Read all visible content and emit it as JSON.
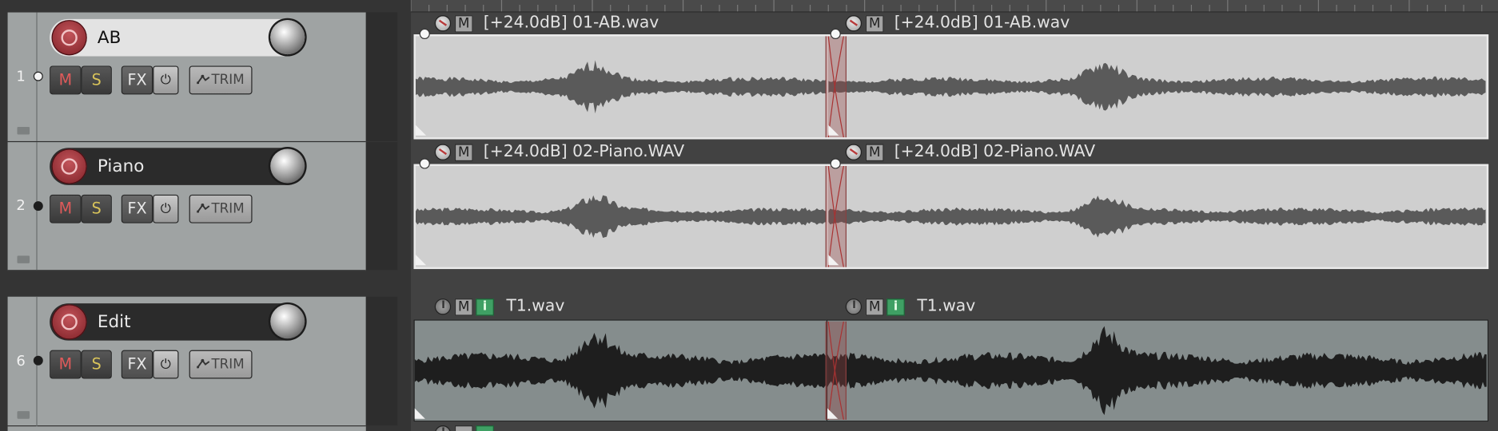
{
  "tracks": [
    {
      "number": "1",
      "name": "AB",
      "selected": true
    },
    {
      "number": "2",
      "name": "Piano",
      "selected": false
    },
    {
      "number": "6",
      "name": "Edit",
      "selected": false
    }
  ],
  "buttons": {
    "mute": "M",
    "solo": "S",
    "fx": "FX",
    "trim": "TRIM"
  },
  "items": {
    "ab_left": {
      "mute": "M",
      "label": "[+24.0dB] 01-AB.wav"
    },
    "ab_right": {
      "mute": "M",
      "label": "[+24.0dB] 01-AB.wav"
    },
    "piano_left": {
      "mute": "M",
      "label": "[+24.0dB] 02-Piano.WAV"
    },
    "piano_right": {
      "mute": "M",
      "label": "[+24.0dB] 02-Piano.WAV"
    },
    "edit_left": {
      "mute": "M",
      "info": "i",
      "label": "T1.wav"
    },
    "edit_right": {
      "mute": "M",
      "info": "i",
      "label": "T1.wav"
    }
  },
  "icons": {
    "record": "record-arm-icon",
    "volume": "volume-knob-icon",
    "power": "power-icon",
    "envelope": "envelope-icon",
    "folder": "folder-icon"
  },
  "colors": {
    "mute_red": "#e05a5a",
    "solo_yellow": "#d8c35a",
    "record_red": "#9a2a30",
    "info_green": "#3fa064"
  }
}
